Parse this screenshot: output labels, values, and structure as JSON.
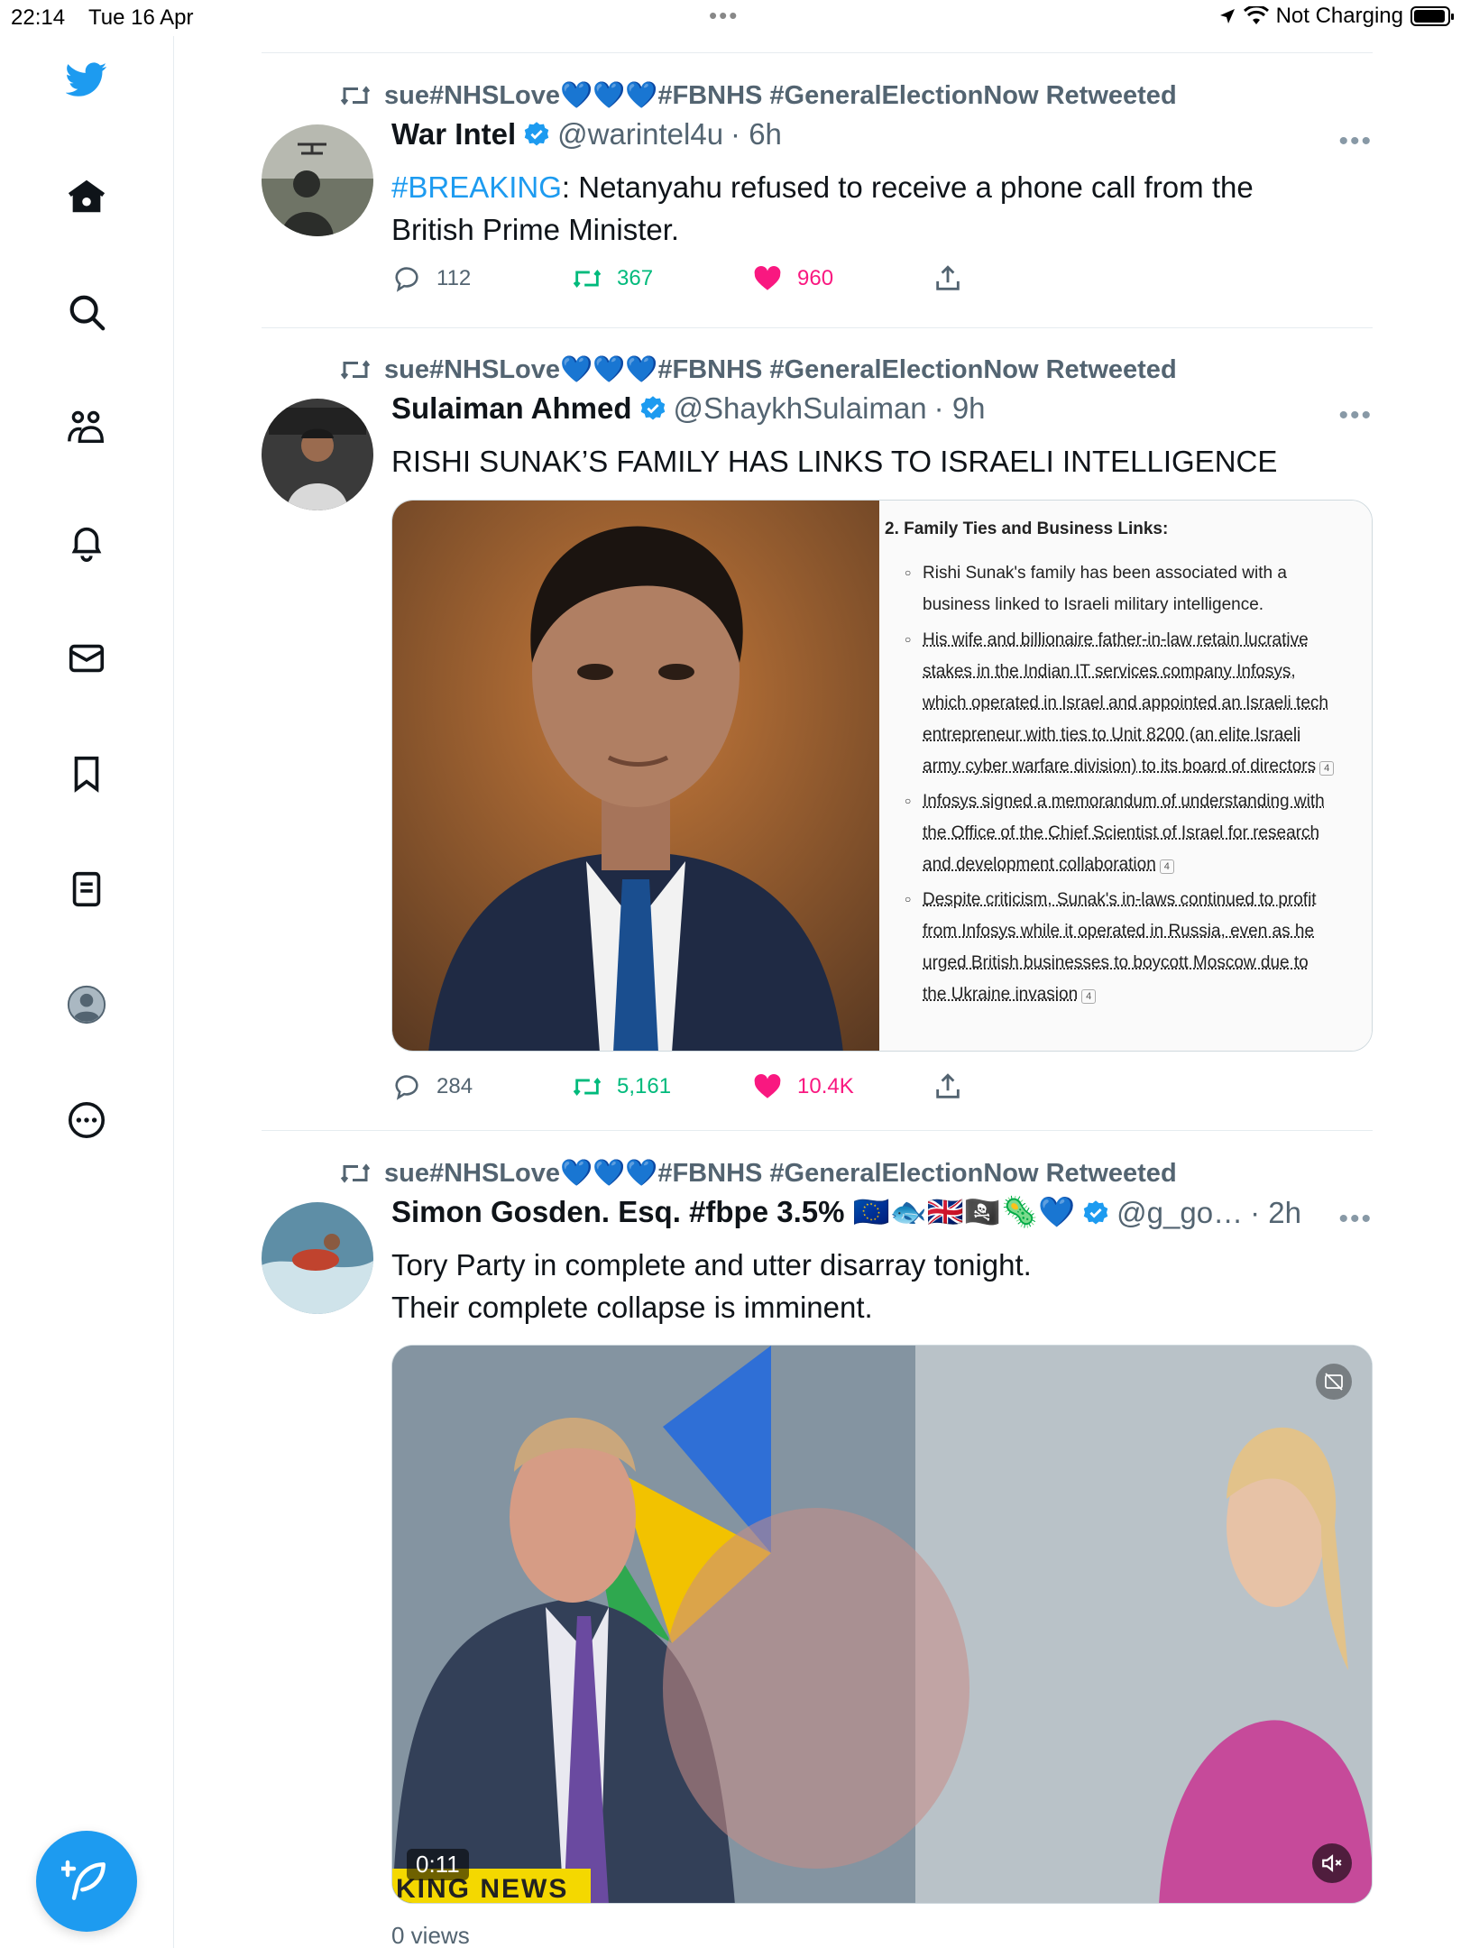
{
  "status_bar": {
    "time": "22:14",
    "date": "Tue 16 Apr",
    "dots": "•••",
    "charging": "Not Charging"
  },
  "sidebar": {
    "items": [
      {
        "icon": "twitter-logo-icon"
      },
      {
        "icon": "home-icon"
      },
      {
        "icon": "search-icon"
      },
      {
        "icon": "communities-icon"
      },
      {
        "icon": "notifications-bell-icon"
      },
      {
        "icon": "messages-envelope-icon"
      },
      {
        "icon": "bookmarks-icon"
      },
      {
        "icon": "lists-icon"
      },
      {
        "icon": "profile-icon"
      },
      {
        "icon": "more-circle-icon"
      }
    ],
    "compose_icon": "compose-feather-icon"
  },
  "colors": {
    "brand": "#1d9bf0",
    "retweet_green": "#00ba7c",
    "like_pink": "#f91880",
    "muted": "#536471"
  },
  "tweets": [
    {
      "retweeted_by": "sue#NHSLove💙💙💙#FBNHS #GeneralElectionNow Retweeted",
      "name": "War Intel",
      "handle": "@warintel4u",
      "time": "· 6h",
      "text_tag": "#BREAKING",
      "text_line1_rest": ": Netanyahu refused to receive a phone call from the",
      "text_line2": "British Prime Minister.",
      "replies": "112",
      "retweets": "367",
      "likes": "960"
    },
    {
      "retweeted_by": "sue#NHSLove💙💙💙#FBNHS #GeneralElectionNow Retweeted",
      "name": "Sulaiman Ahmed",
      "handle": "@ShaykhSulaiman",
      "time": "· 9h",
      "text": "RISHI SUNAK’S FAMILY HAS LINKS TO ISRAELI INTELLIGENCE",
      "image_doc": {
        "heading": "2. Family Ties and Business Links:",
        "bullets": [
          [
            "Rishi Sunak's family has been associated with a",
            "business linked to Israeli military intelligence."
          ],
          [
            "His wife and billionaire father-in-law retain lucrative",
            "stakes in the Indian IT services company Infosys,",
            "which operated in Israel and appointed an Israeli tech",
            "entrepreneur with ties to Unit 8200 (an elite Israeli",
            "army cyber warfare division) to its board of directors"
          ],
          [
            "Infosys signed a memorandum of understanding with",
            "the Office of the Chief Scientist of Israel for research",
            "and development collaboration"
          ],
          [
            "Despite criticism, Sunak's in-laws continued to profit",
            "from Infosys while it operated in Russia, even as he",
            "urged British businesses to boycott Moscow due to",
            "the Ukraine invasion"
          ]
        ],
        "cite": "4"
      },
      "replies": "284",
      "retweets": "5,161",
      "likes": "10.4K"
    },
    {
      "retweeted_by": "sue#NHSLove💙💙💙#FBNHS #GeneralElectionNow Retweeted",
      "name": "Simon Gosden. Esq. #fbpe 3.5% 🇪🇺🐟🇬🇧🏴‍☠️🦠💙",
      "handle": "@g_go…",
      "time": "· 2h",
      "text_line1": "Tory Party in complete and utter disarray tonight.",
      "text_line2": "Their complete collapse is imminent.",
      "video_time": "0:11",
      "video_banner": "KING NEWS",
      "views": "0 views"
    }
  ]
}
